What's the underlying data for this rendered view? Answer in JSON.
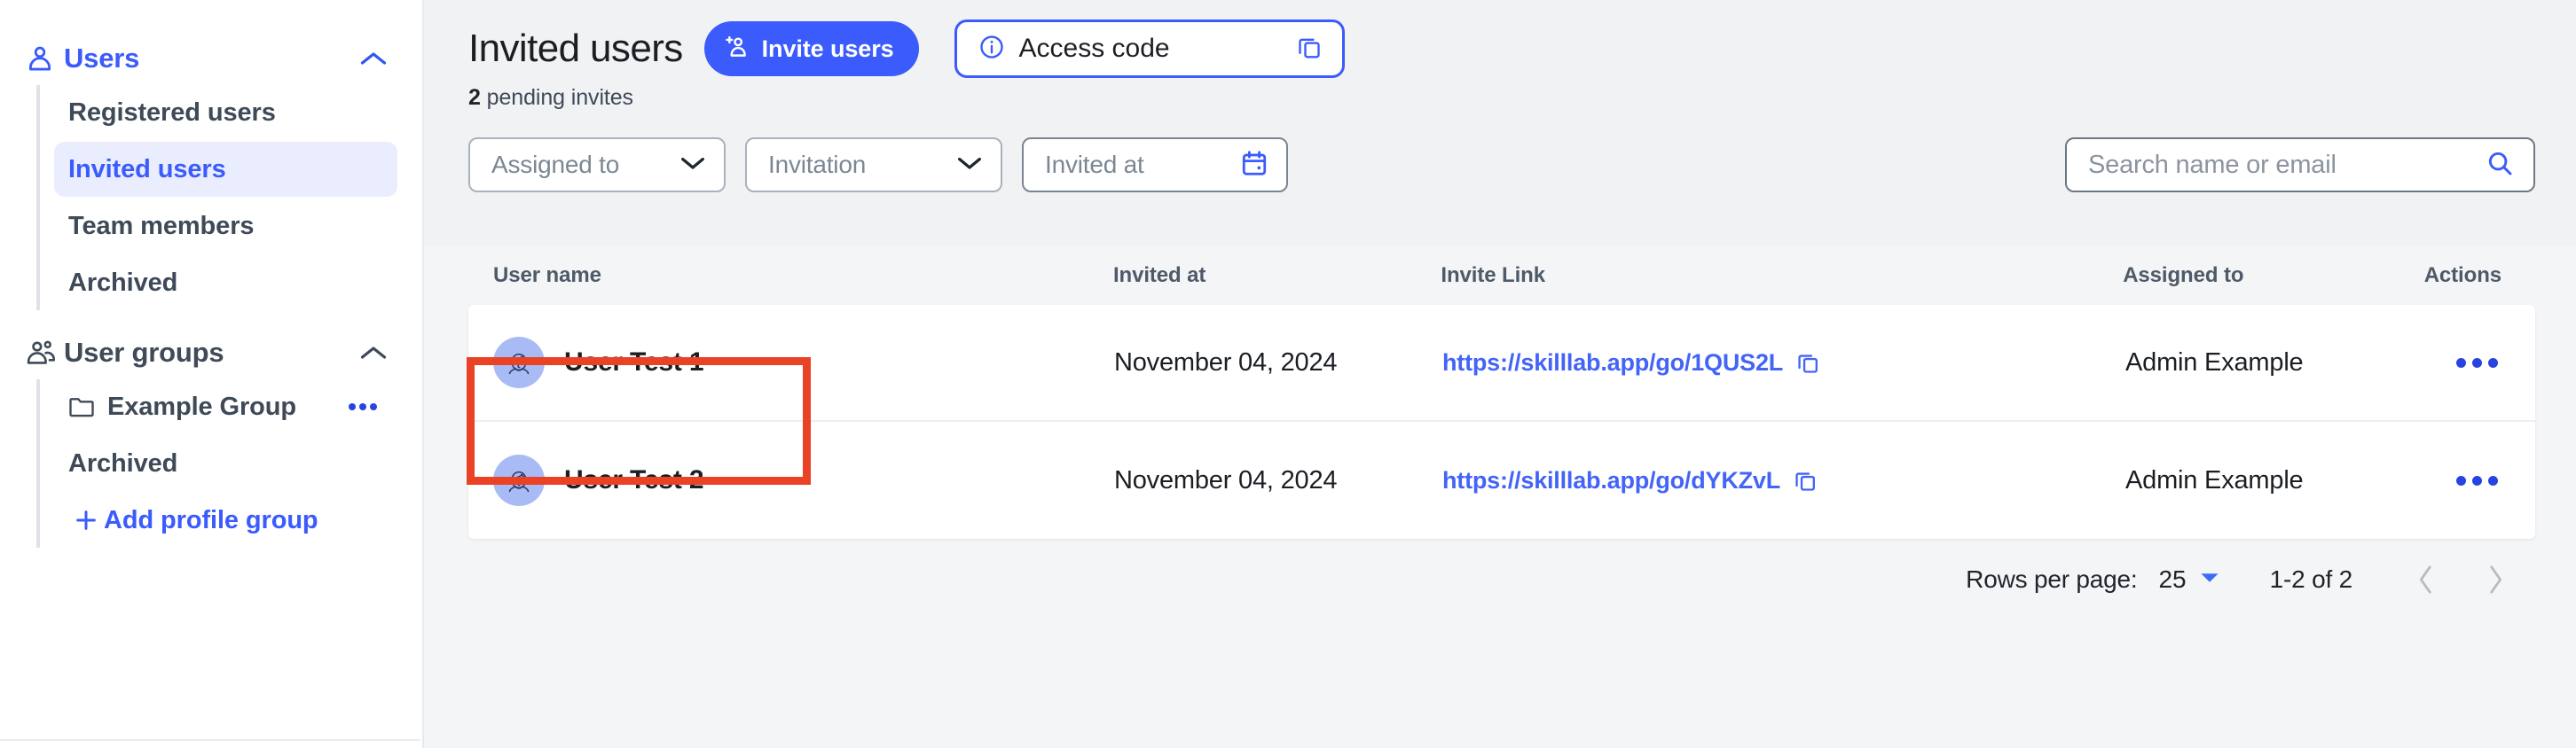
{
  "sidebar": {
    "sections": [
      {
        "id": "users",
        "label": "Users",
        "icon": "user-icon",
        "accent": true,
        "chevron": "chevron-up-icon",
        "items": [
          {
            "label": "Registered users",
            "active": false
          },
          {
            "label": "Invited users",
            "active": true
          },
          {
            "label": "Team members",
            "active": false
          },
          {
            "label": "Archived",
            "active": false
          }
        ]
      },
      {
        "id": "user-groups",
        "label": "User groups",
        "icon": "users-group-icon",
        "accent": false,
        "chevron": "chevron-up-icon",
        "items": [
          {
            "label": "Example Group",
            "icon": "folder-icon",
            "menu": "kebab-icon"
          },
          {
            "label": "Archived"
          },
          {
            "label": "Add profile group",
            "icon": "plus-icon",
            "is_link": true
          }
        ]
      }
    ]
  },
  "header": {
    "title": "Invited users",
    "invite_button": "Invite users",
    "invite_icon": "user-plus-icon",
    "access_code": {
      "label": "Access code",
      "info_icon": "info-icon",
      "copy_icon": "copy-icon"
    },
    "pending_count": "2",
    "pending_text": "pending invites"
  },
  "filters": {
    "assigned_to": {
      "label": "Assigned to",
      "icon": "chevron-down-icon"
    },
    "invitation": {
      "label": "Invitation",
      "icon": "chevron-down-icon"
    },
    "invited_at": {
      "label": "Invited at",
      "icon": "calendar-icon"
    },
    "search": {
      "value": "",
      "placeholder": "Search name or email",
      "icon": "search-icon"
    }
  },
  "table": {
    "columns": [
      "User name",
      "Invited at",
      "Invite Link",
      "Assigned to",
      "Actions"
    ],
    "rows": [
      {
        "name": "User Test 1",
        "avatar": "avatar-icon",
        "invited_at": "November 04, 2024",
        "invite_link": "https://skilllab.app/go/1QUS2L",
        "copy_icon": "copy-icon",
        "assigned_to": "Admin Example",
        "actions_icon": "kebab-icon"
      },
      {
        "name": "User Test 2",
        "avatar": "avatar-icon",
        "invited_at": "November 04, 2024",
        "invite_link": "https://skilllab.app/go/dYKZvL",
        "copy_icon": "copy-icon",
        "assigned_to": "Admin Example",
        "actions_icon": "kebab-icon"
      }
    ]
  },
  "pagination": {
    "rows_per_page_label": "Rows per page:",
    "rows_per_page_value": "25",
    "dropdown_icon": "caret-down-icon",
    "range": "1-2 of 2",
    "prev_icon": "chevron-left-icon",
    "next_icon": "chevron-right-icon"
  },
  "annotation": {
    "type": "highlight-rectangle",
    "color": "#ea4224",
    "targets": "User Test 1 row name cell"
  },
  "colors": {
    "accent": "#3b5bfd",
    "link": "#4364f7",
    "active_nav_bg": "#e9edfd",
    "text": "#1b1f24",
    "muted": "#7c8794",
    "page_bg": "#f2f3f5",
    "annotation": "#ea4224"
  }
}
